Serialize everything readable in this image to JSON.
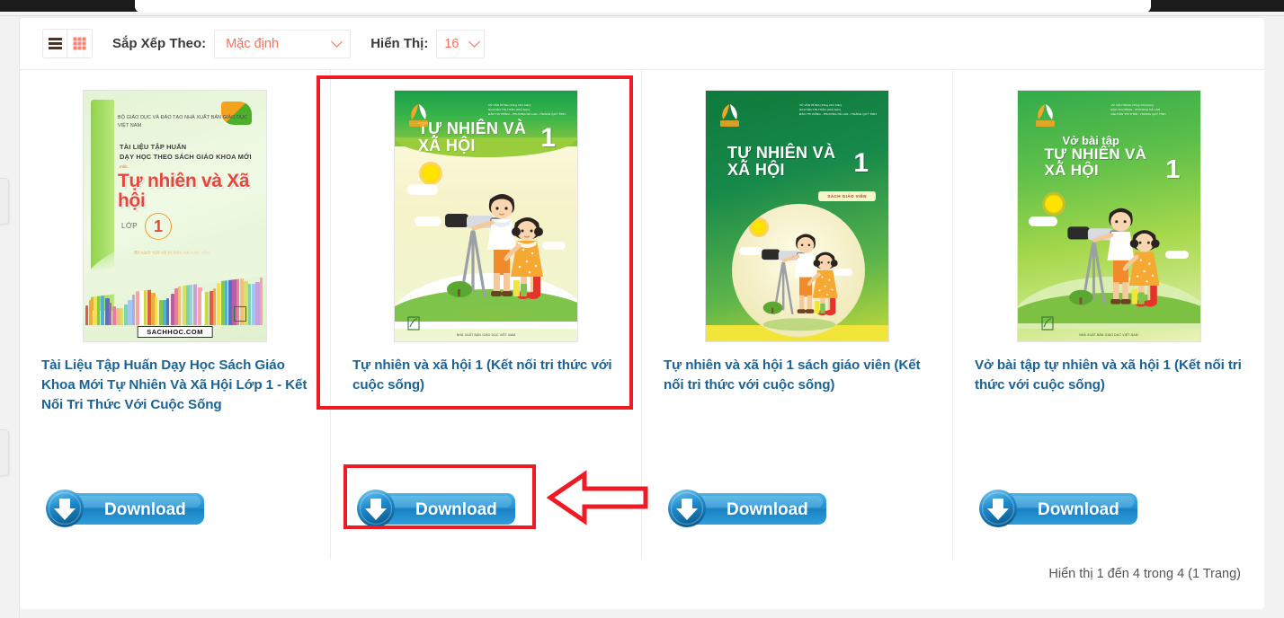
{
  "page": {
    "background_color": "#f2f2f2",
    "panel_color": "#ffffff"
  },
  "toolbar": {
    "list_view_icon": "list-view-icon",
    "grid_view_icon": "grid-view-icon",
    "list_view_color": "#4a3426",
    "grid_view_color": "#fa8072",
    "sort_label": "Sắp Xếp Theo:",
    "sort_value": "Mặc định",
    "sort_options": [
      "Mặc định"
    ],
    "limit_label": "Hiển Thị:",
    "limit_value": "16",
    "limit_options": [
      "16"
    ],
    "accent_color": "#f3705a"
  },
  "products": [
    {
      "title": "Tài Liệu Tập Huấn Dạy Học Sách Giáo Khoa Mới Tự Nhiên Và Xã Hội Lớp 1 - Kết Nối Tri Thức Với Cuộc Sống",
      "download_label": "Download",
      "cover": {
        "ministry_line": "BỘ GIÁO DỤC VÀ ĐÀO TẠO\nNHÀ XUẤT BẢN GIÁO DỤC VIỆT NAM",
        "line1": "TÀI LIỆU TẬP HUẤN",
        "line2": "DẠY HỌC THEO SÁCH GIÁO KHOA MỚI",
        "mon": "môn",
        "title": "Tự nhiên và Xã hội",
        "grade_label": "LỚP",
        "grade_number": "1",
        "script": "Bộ sách: Kết nối tri thức với cuộc sống",
        "watermark": "SACHHOC.COM"
      }
    },
    {
      "title": "Tự nhiên và xã hội 1 (Kết nối tri thức với cuộc sống)",
      "download_label": "Download",
      "highlighted": true,
      "cover": {
        "authors": "VŨ VĂN HÙNG (Tổng Chủ biên)\nNGUYỄN THỊ THẤN (Chủ biên)\nĐÀO THỊ HỒNG - PHƯƠNG HÀ LAN - HOÀNG QUÝ TỈNH",
        "title": "TỰ NHIÊN VÀ XÃ HỘI",
        "number": "1",
        "publisher": "NHÀ XUẤT BẢN GIÁO DỤC VIỆT NAM"
      }
    },
    {
      "title": "Tự nhiên và xã hội 1 sách giáo viên (Kết nối tri thức với cuộc sống)",
      "download_label": "Download",
      "cover": {
        "authors": "VŨ VĂN HÙNG (Tổng Chủ biên)\nNGUYỄN THỊ THẤN (Chủ biên)\nĐÀO THỊ HỒNG - PHƯƠNG HÀ LAN - HOÀNG QUÝ TỈNH",
        "title": "TỰ NHIÊN VÀ XÃ HỘI",
        "number": "1",
        "badge": "SÁCH GIÁO VIÊN",
        "publisher": "NHÀ XUẤT BẢN GIÁO DỤC VIỆT NAM"
      }
    },
    {
      "title": "Vở bài tập tự nhiên và xã hội 1 (Kết nối tri thức với cuộc sống)",
      "download_label": "Download",
      "cover": {
        "authors": "VŨ VĂN HÙNG (Tổng Chủ biên)\nĐÀO THỊ HỒNG - PHƯƠNG HÀ LAN\nNGUYỄN THỊ THẤN - HOÀNG QUÝ TỈNH",
        "prefix": "Vở bài tập",
        "title": "TỰ NHIÊN VÀ XÃ HỘI",
        "number": "1",
        "publisher": "NHÀ XUẤT BẢN GIÁO DỤC VIỆT NAM"
      }
    }
  ],
  "footer": {
    "pagination_text": "Hiển thị 1 đến 4 trong 4 (1 Trang)"
  },
  "annotations": {
    "color": "#ee1b24",
    "product_highlight_index": 1,
    "download_highlight_index": 1,
    "arrow_icon": "left-arrow-annotation",
    "arrow_direction": "left"
  }
}
